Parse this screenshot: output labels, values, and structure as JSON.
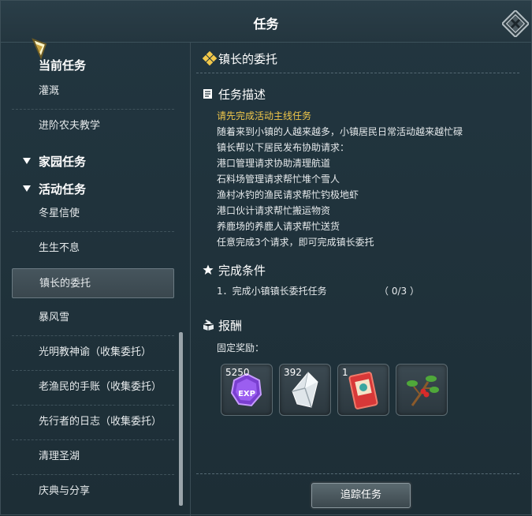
{
  "window": {
    "title": "任务"
  },
  "sidebar": {
    "current_header": "当前任务",
    "current_items": [
      "灌溉",
      "进阶农夫教学"
    ],
    "home_header": "家园任务",
    "activity_header": "活动任务",
    "activity_items": [
      "冬星信使",
      "生生不息",
      "镇长的委托",
      "暴风雪",
      "光明教神谕（收集委托）",
      "老渔民的手账（收集委托）",
      "先行者的日志（收集委托）",
      "清理圣湖",
      "庆典与分享"
    ],
    "selected": "镇长的委托"
  },
  "quest": {
    "title": "镇长的委托",
    "desc_header": "任务描述",
    "warning": "请先完成活动主线任务",
    "desc_lines": [
      "随着来到小镇的人越来越多，小镇居民日常活动越来越忙碌",
      "镇长帮以下居民发布协助请求：",
      "港口管理请求协助清理航道",
      "石料场管理请求帮忙堆个雪人",
      "渔村冰钓的渔民请求帮忙钓极地虾",
      "港口伙计请求帮忙搬运物资",
      "养鹿场的养鹿人请求帮忙送货",
      "任意完成3个请求，即可完成镇长委托"
    ],
    "cond_header": "完成条件",
    "cond_text": "1．完成小镇镇长委托任务",
    "cond_progress": "（ 0/3 ）",
    "reward_header": "报酬",
    "fixed_label": "固定奖励：",
    "rewards": [
      {
        "icon": "exp-icon",
        "count": "5250"
      },
      {
        "icon": "crystal-icon",
        "count": "392"
      },
      {
        "icon": "ticket-icon",
        "count": "1"
      },
      {
        "icon": "holly-branch-icon",
        "count": ""
      }
    ],
    "track_button": "追踪任务"
  },
  "colors": {
    "accent": "#f2c84b",
    "bg": "#1f3039"
  }
}
